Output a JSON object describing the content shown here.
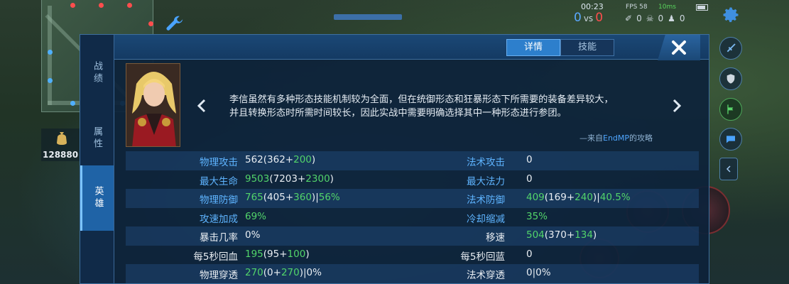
{
  "hud": {
    "timer": "00:23",
    "score_blue": "0",
    "score_vs": "vs",
    "score_red": "0",
    "fps": "FPS 58",
    "ping": "10ms",
    "kills": "0",
    "deaths": "0",
    "assists": "0",
    "gold": "128880"
  },
  "modal": {
    "tabs": [
      "详情",
      "技能"
    ],
    "active_tab": "详情",
    "side_tabs": [
      "战绩",
      "属性",
      "英雄"
    ],
    "active_side_tab": "英雄",
    "description_line1": "李信虽然有多种形态技能机制较为全面，但在统御形态和狂暴形态下所需要的装备差异较大，",
    "description_line2": "并且转换形态时所需时间较长，因此实战中需要明确选择其中一种形态进行参团。",
    "source_prefix": "—来自",
    "source_author": "EndMP",
    "source_suffix": "的攻略"
  },
  "stats": [
    {
      "left_label": "物理攻击",
      "left_label_color": "blue",
      "left_value": [
        [
          "562(362+",
          "w"
        ],
        [
          "200",
          "g"
        ],
        [
          ")",
          "w"
        ]
      ],
      "right_label": "法术攻击",
      "right_label_color": "blue",
      "right_value": [
        [
          "0",
          "w"
        ]
      ]
    },
    {
      "left_label": "最大生命",
      "left_label_color": "blue",
      "left_value": [
        [
          "9503",
          "g"
        ],
        [
          "(7203+",
          "w"
        ],
        [
          "2300",
          "g"
        ],
        [
          ")",
          "w"
        ]
      ],
      "right_label": "最大法力",
      "right_label_color": "blue",
      "right_value": [
        [
          "0",
          "w"
        ]
      ]
    },
    {
      "left_label": "物理防御",
      "left_label_color": "blue",
      "left_value": [
        [
          "765",
          "g"
        ],
        [
          "(405+",
          "w"
        ],
        [
          "360",
          "g"
        ],
        [
          ")|",
          "w"
        ],
        [
          "56%",
          "g"
        ]
      ],
      "right_label": "法术防御",
      "right_label_color": "blue",
      "right_value": [
        [
          "409",
          "g"
        ],
        [
          "(169+",
          "w"
        ],
        [
          "240",
          "g"
        ],
        [
          ")|",
          "w"
        ],
        [
          "40.5%",
          "g"
        ]
      ]
    },
    {
      "left_label": "攻速加成",
      "left_label_color": "blue",
      "left_value": [
        [
          "69%",
          "g"
        ]
      ],
      "right_label": "冷却缩减",
      "right_label_color": "blue",
      "right_value": [
        [
          "35%",
          "g"
        ]
      ]
    },
    {
      "left_label": "暴击几率",
      "left_label_color": "white",
      "left_value": [
        [
          "0%",
          "w"
        ]
      ],
      "right_label": "移速",
      "right_label_color": "white",
      "right_value": [
        [
          "504",
          "g"
        ],
        [
          "(370+",
          "w"
        ],
        [
          "134",
          "g"
        ],
        [
          ")",
          "w"
        ]
      ]
    },
    {
      "left_label": "每5秒回血",
      "left_label_color": "white",
      "left_value": [
        [
          "195",
          "g"
        ],
        [
          "(95+",
          "w"
        ],
        [
          "100",
          "g"
        ],
        [
          ")",
          "w"
        ]
      ],
      "right_label": "每5秒回蓝",
      "right_label_color": "white",
      "right_value": [
        [
          "0",
          "w"
        ]
      ]
    },
    {
      "left_label": "物理穿透",
      "left_label_color": "white",
      "left_value": [
        [
          "270",
          "g"
        ],
        [
          "(0+",
          "w"
        ],
        [
          "270",
          "g"
        ],
        [
          ")|0%",
          "w"
        ]
      ],
      "right_label": "法术穿透",
      "right_label_color": "white",
      "right_value": [
        [
          "0|0%",
          "w"
        ]
      ]
    }
  ],
  "colors": {
    "accent": "#2d7fcc",
    "stat_blue": "#5eb4ff",
    "stat_green": "#52d46a",
    "panel": "#0d223a"
  },
  "icons": [
    "wrench-icon",
    "gear-icon",
    "sword-icon",
    "shield-icon",
    "flag-icon",
    "chat-icon",
    "collapse-arrow-icon",
    "close-icon",
    "prev-arrow-icon",
    "next-arrow-icon",
    "money-bag-icon"
  ]
}
